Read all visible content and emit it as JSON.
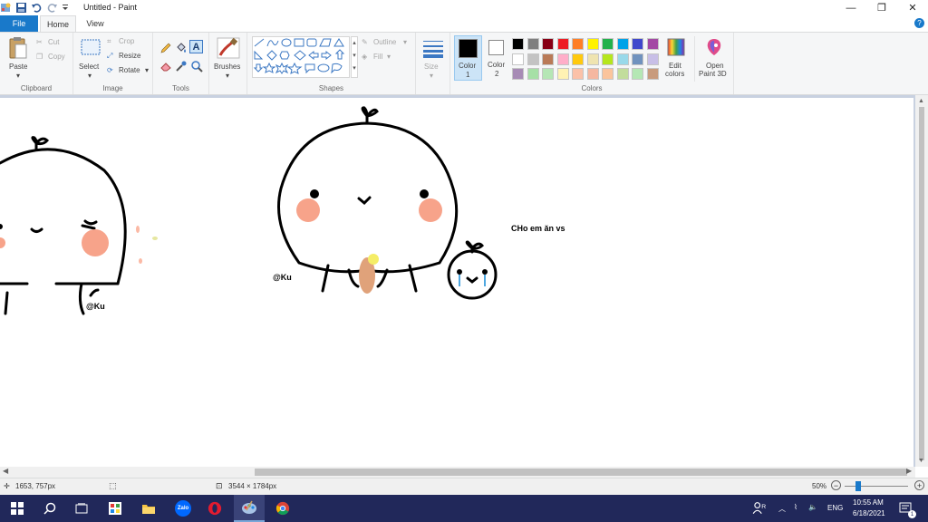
{
  "window": {
    "title": "Untitled - Paint",
    "controls": [
      "—",
      "❐",
      "✕"
    ]
  },
  "menu": {
    "file": "File",
    "home": "Home",
    "view": "View",
    "help": "?"
  },
  "ribbon": {
    "clipboard": {
      "label": "Clipboard",
      "paste": "Paste",
      "cut": "Cut",
      "copy": "Copy"
    },
    "image": {
      "label": "Image",
      "select": "Select",
      "crop": "Crop",
      "resize": "Resize",
      "rotate": "Rotate"
    },
    "tools": {
      "label": "Tools"
    },
    "brushes": {
      "label": "Brushes"
    },
    "shapes": {
      "label": "Shapes",
      "outline": "Outline",
      "fill": "Fill"
    },
    "size": {
      "label": "Size"
    },
    "color1": {
      "label": "Color",
      "sub": "1",
      "value": "#000000"
    },
    "color2": {
      "label": "Color",
      "sub": "2",
      "value": "#ffffff"
    },
    "colors": {
      "label": "Colors"
    },
    "edit_colors": {
      "line1": "Edit",
      "line2": "colors"
    },
    "paint3d": {
      "line1": "Open",
      "line2": "Paint 3D"
    }
  },
  "palette": [
    [
      "#000000",
      "#7f7f7f",
      "#880015",
      "#ed1c24",
      "#ff7f27",
      "#fff200",
      "#22b14c",
      "#00a2e8",
      "#3f48cc",
      "#a349a4"
    ],
    [
      "#ffffff",
      "#c3c3c3",
      "#b97a57",
      "#ffaec9",
      "#ffc90e",
      "#efe4b0",
      "#b5e61d",
      "#99d9ea",
      "#7092be",
      "#c8bfe7"
    ],
    [
      "#a78bb5",
      "#a6e0a6",
      "#b5e6b5",
      "#fff2b3",
      "#fbc1a8",
      "#f5b7a0",
      "#fbc49c",
      "#c2dd9c",
      "#b4e7b4",
      "#c89b7d"
    ]
  ],
  "canvas": {
    "texts": {
      "watermark1": "@Ku",
      "watermark2": "@Ku",
      "caption": "CHo em ăn vs"
    }
  },
  "status": {
    "cursor_pos": "1653, 757px",
    "image_size": "3544 × 1784px",
    "zoom": "50%",
    "zoom_slider": 0.5
  },
  "taskbar": {
    "time": "10:55 AM",
    "date": "6/18/2021",
    "lang": "ENG",
    "notif_count": "1",
    "zalo": "Zalo"
  }
}
